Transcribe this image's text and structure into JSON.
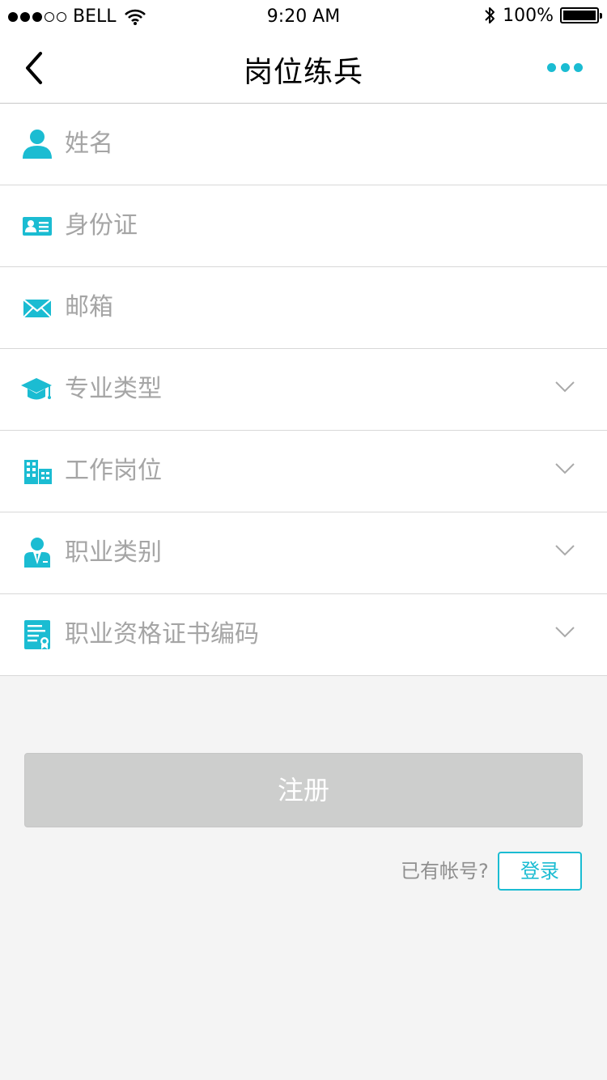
{
  "status_bar": {
    "carrier": "BELL",
    "time": "9:20 AM",
    "battery": "100%",
    "battery_level": 1.0,
    "signal_bars": 3,
    "signal_total": 5,
    "icons": [
      "wifi-icon",
      "bluetooth-icon",
      "battery-icon"
    ]
  },
  "nav": {
    "title": "岗位练兵",
    "back_icon": "chevron-left-icon",
    "more_icon": "more-dots-icon"
  },
  "form": {
    "fields": [
      {
        "label": "姓名",
        "icon": "user-icon",
        "dropdown": false
      },
      {
        "label": "身份证",
        "icon": "id-card-icon",
        "dropdown": false
      },
      {
        "label": "邮箱",
        "icon": "mail-icon",
        "dropdown": false
      },
      {
        "label": "专业类型",
        "icon": "graduation-cap-icon",
        "dropdown": true
      },
      {
        "label": "工作岗位",
        "icon": "building-icon",
        "dropdown": true
      },
      {
        "label": "职业类别",
        "icon": "worker-icon",
        "dropdown": true
      },
      {
        "label": "职业资格证书编码",
        "icon": "certificate-icon",
        "dropdown": true
      }
    ]
  },
  "actions": {
    "register_label": "注册",
    "login_hint": "已有帐号?",
    "login_label": "登录"
  },
  "colors": {
    "accent": "#1bbcd2",
    "placeholder": "#a5a5a5",
    "button_disabled": "#cdcecd",
    "background": "#f4f4f4"
  }
}
